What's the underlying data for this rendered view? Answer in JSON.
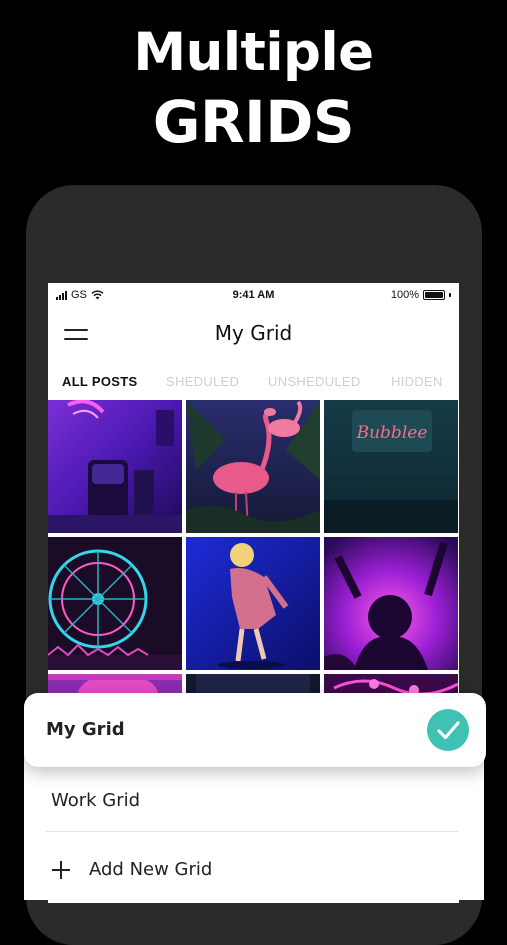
{
  "headline": {
    "line1": "Multiple",
    "line2": "GRIDS"
  },
  "status_bar": {
    "carrier": "GS",
    "time": "9:41 AM",
    "battery": "100%",
    "battery_level": 1.0,
    "icons": [
      "signal-icon",
      "wifi-icon",
      "battery-icon"
    ]
  },
  "app": {
    "title": "My Grid",
    "menu_icon": "hamburger-menu-icon"
  },
  "tabs": [
    {
      "label": "ALL POSTS",
      "active": true
    },
    {
      "label": "SHEDULED",
      "active": false
    },
    {
      "label": "UNSHEDULED",
      "active": false
    },
    {
      "label": "HIDDEN",
      "active": false
    }
  ],
  "grid_photos": [
    {
      "subject": "neon-purple-room"
    },
    {
      "subject": "flamingos"
    },
    {
      "subject": "neon-sign-bubbles",
      "sign_text": "Bubblee"
    },
    {
      "subject": "ferris-wheel-night"
    },
    {
      "subject": "dancer-on-stage"
    },
    {
      "subject": "concert-crowd"
    },
    {
      "subject": "pink-lights"
    },
    {
      "subject": "dark-scene"
    },
    {
      "subject": "neon-bar"
    }
  ],
  "grid_menu": {
    "selected": {
      "label": "My Grid",
      "icon": "checkmark-icon",
      "accent": "#3fc1b3"
    },
    "items": [
      {
        "label": "Work Grid"
      }
    ],
    "add_label": "Add New Grid",
    "add_icon": "plus-icon"
  }
}
